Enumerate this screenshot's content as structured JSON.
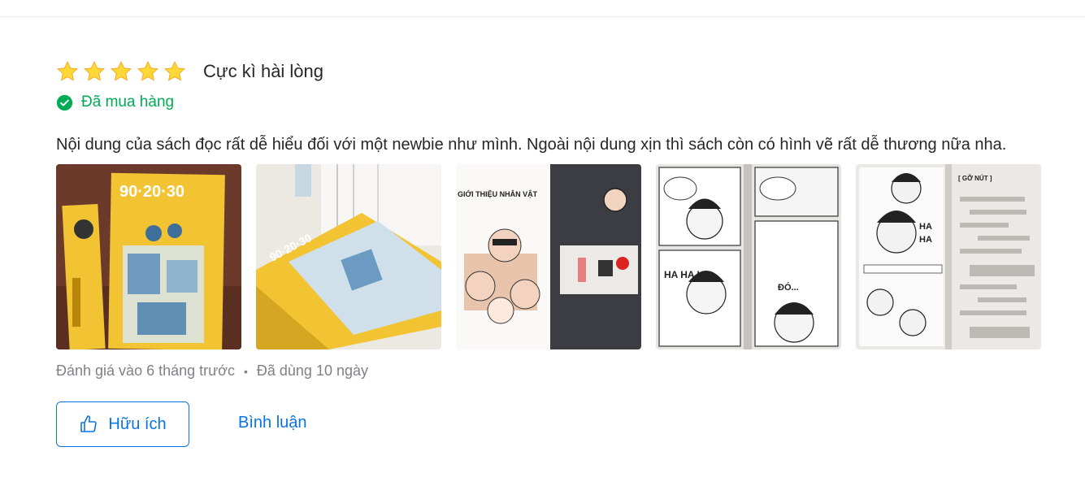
{
  "review": {
    "rating": 5,
    "rating_max": 5,
    "rating_title": "Cực kì hài lòng",
    "purchased_label": "Đã mua hàng",
    "text": "Nội dung của sách đọc rất dễ hiểu đối với một newbie như mình. Ngoài nội dung xịn thì sách còn có hình vẽ rất dễ thương nữa nha.",
    "photos": [
      {
        "icon": "book-cover-photo"
      },
      {
        "icon": "book-spine-photo"
      },
      {
        "icon": "character-intro-page-photo"
      },
      {
        "icon": "comic-page-photo"
      },
      {
        "icon": "comic-chat-page-photo"
      }
    ],
    "photo_texts": {
      "cover_title": "90·20·30",
      "page_heading": "GIỚI THIỆU NHÂN VẬT",
      "comic_laugh": "HA HA HA",
      "comic_ellipsis": "ĐÓ...",
      "chat_header": "[ GỠ NÚT ]"
    },
    "meta": {
      "reviewed": "Đánh giá vào 6 tháng trước",
      "separator": "•",
      "used": "Đã dùng 10 ngày"
    },
    "actions": {
      "helpful_label": "Hữu ích",
      "comment_label": "Bình luận"
    }
  },
  "colors": {
    "star": "#fdd836",
    "purchased": "#00ab56",
    "link": "#0b74e5",
    "text": "#27272a",
    "muted": "#808089"
  }
}
